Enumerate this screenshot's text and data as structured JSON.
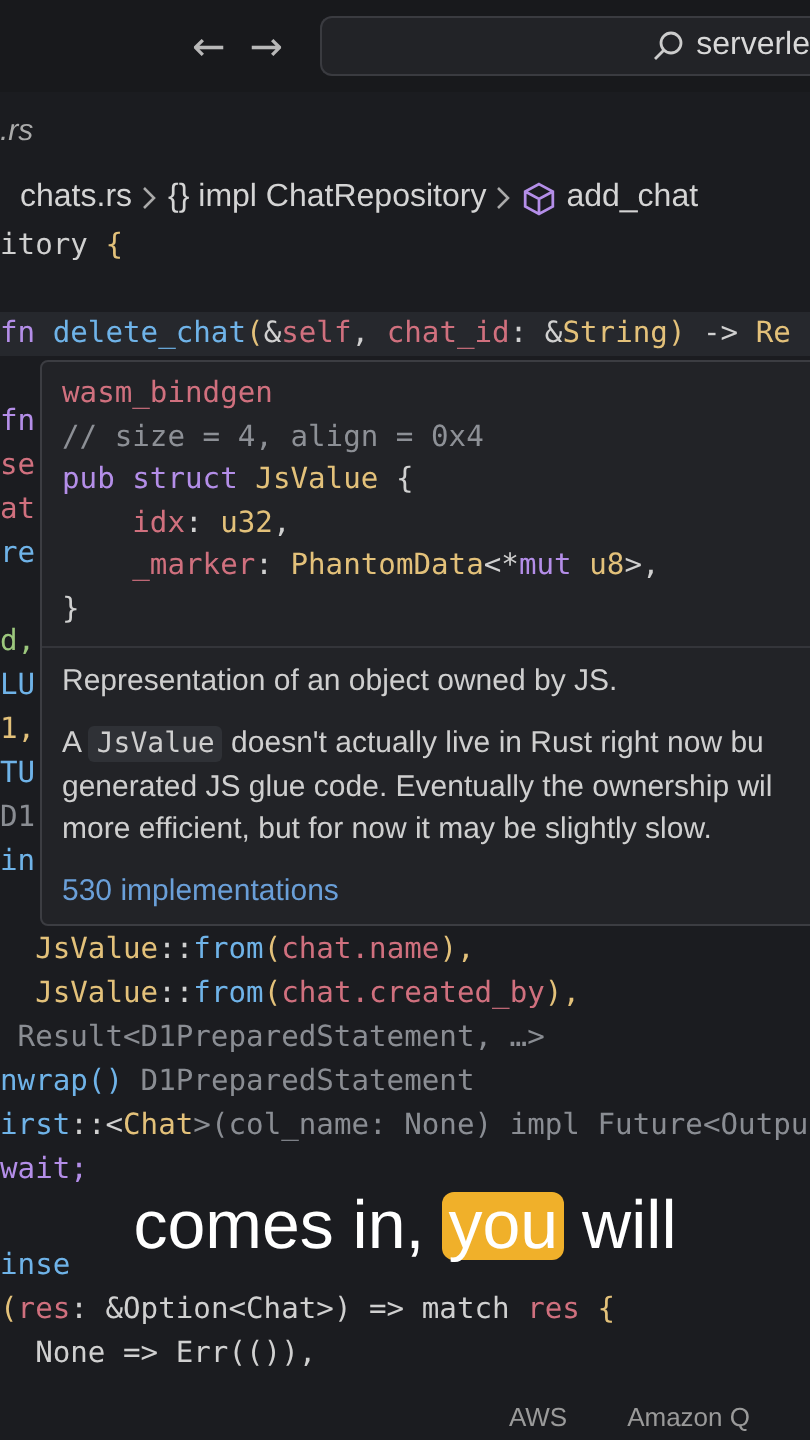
{
  "topbar": {
    "back": "←",
    "forward": "→",
    "search": "serverle"
  },
  "tab": {
    "label": ".rs"
  },
  "breadcrumb": [
    {
      "text": "chats.rs",
      "kind": "file"
    },
    {
      "text": "{} impl ChatRepository",
      "kind": "scope"
    },
    {
      "text": "add_chat",
      "kind": "method"
    }
  ],
  "code_blocks": [
    [
      {
        "segments": [
          {
            "text": "itory ",
            "kind": "plain"
          },
          {
            "text": "{",
            "kind": "type"
          }
        ]
      }
    ],
    [
      {
        "current": true,
        "segments": [
          {
            "text": "fn ",
            "kind": "kw"
          },
          {
            "text": "delete_chat",
            "kind": "fn"
          },
          {
            "text": "(",
            "kind": "type"
          },
          {
            "text": "&",
            "kind": "plain"
          },
          {
            "text": "self",
            "kind": "var"
          },
          {
            "text": ", ",
            "kind": "plain"
          },
          {
            "text": "chat_id",
            "kind": "var"
          },
          {
            "text": ": &",
            "kind": "plain"
          },
          {
            "text": "String",
            "kind": "type"
          },
          {
            "text": ")",
            "kind": "type"
          },
          {
            "text": " -> ",
            "kind": "plain"
          },
          {
            "text": "Re",
            "kind": "type"
          }
        ]
      }
    ],
    [
      {
        "segments": [
          {
            "text": "fn",
            "kind": "kw"
          }
        ]
      },
      {
        "segments": [
          {
            "text": "se",
            "kind": "var"
          }
        ]
      },
      {
        "segments": [
          {
            "text": "at",
            "kind": "var"
          }
        ]
      },
      {
        "segments": [
          {
            "text": "re",
            "kind": "fn"
          }
        ]
      }
    ],
    [
      {
        "segments": [
          {
            "text": "d,",
            "kind": "str"
          }
        ]
      },
      {
        "segments": [
          {
            "text": "LU",
            "kind": "fn"
          }
        ]
      },
      {
        "segments": [
          {
            "text": "1,",
            "kind": "type"
          }
        ]
      },
      {
        "segments": [
          {
            "text": "TU",
            "kind": "fn"
          }
        ]
      },
      {
        "segments": [
          {
            "text": "D1",
            "kind": "hint"
          }
        ]
      },
      {
        "segments": [
          {
            "text": "in",
            "kind": "fn"
          }
        ]
      }
    ],
    [
      {
        "segments": [
          {
            "text": "  JsValue",
            "kind": "type"
          },
          {
            "text": "::",
            "kind": "plain"
          },
          {
            "text": "from",
            "kind": "fn"
          },
          {
            "text": "(",
            "kind": "type"
          },
          {
            "text": "chat.name",
            "kind": "var"
          },
          {
            "text": "),",
            "kind": "type"
          }
        ]
      },
      {
        "segments": [
          {
            "text": "  JsValue",
            "kind": "type"
          },
          {
            "text": "::",
            "kind": "plain"
          },
          {
            "text": "from",
            "kind": "fn"
          },
          {
            "text": "(",
            "kind": "type"
          },
          {
            "text": "chat.created_by",
            "kind": "var"
          },
          {
            "text": "),",
            "kind": "type"
          }
        ]
      },
      {
        "segments": [
          {
            "text": " Result<D1PreparedStatement, …>",
            "kind": "hint"
          }
        ]
      },
      {
        "segments": [
          {
            "text": "nwrap() ",
            "kind": "fn"
          },
          {
            "text": "D1PreparedStatement",
            "kind": "hint"
          }
        ]
      },
      {
        "segments": [
          {
            "text": "irst",
            "kind": "fn"
          },
          {
            "text": "::<",
            "kind": "plain"
          },
          {
            "text": "Chat",
            "kind": "type"
          },
          {
            "text": ">(col_name: None) impl Future<Outpu",
            "kind": "hint"
          }
        ]
      },
      {
        "segments": [
          {
            "text": "wait;",
            "kind": "kw"
          }
        ]
      }
    ],
    [
      {
        "segments": [
          {
            "text": "inse",
            "kind": "fn"
          }
        ]
      },
      {
        "segments": [
          {
            "text": "(",
            "kind": "type"
          },
          {
            "text": "res",
            "kind": "var"
          },
          {
            "text": ": &Option<Chat>) => match ",
            "kind": "plain"
          },
          {
            "text": "res",
            "kind": "var"
          },
          {
            "text": " {",
            "kind": "type"
          }
        ]
      },
      {
        "segments": [
          {
            "text": "  None => Err(()),",
            "kind": "plain"
          }
        ]
      }
    ]
  ],
  "hover": {
    "signature": [
      [
        {
          "text": "wasm_bindgen",
          "kind": "var"
        }
      ],
      [
        {
          "text": "// size = 4, align = 0x4",
          "kind": "comment"
        }
      ],
      [
        {
          "text": "pub struct ",
          "kind": "kw"
        },
        {
          "text": "JsValue ",
          "kind": "type"
        },
        {
          "text": "{",
          "kind": "plain"
        }
      ],
      [
        {
          "text": "    idx",
          "kind": "var"
        },
        {
          "text": ": ",
          "kind": "plain"
        },
        {
          "text": "u32",
          "kind": "type"
        },
        {
          "text": ",",
          "kind": "plain"
        }
      ],
      [
        {
          "text": "    _marker",
          "kind": "var"
        },
        {
          "text": ": ",
          "kind": "plain"
        },
        {
          "text": "PhantomData",
          "kind": "type"
        },
        {
          "text": "<*",
          "kind": "plain"
        },
        {
          "text": "mut ",
          "kind": "kw"
        },
        {
          "text": "u8",
          "kind": "type"
        },
        {
          "text": ">,",
          "kind": "plain"
        }
      ],
      [
        {
          "text": "}",
          "kind": "plain"
        }
      ]
    ],
    "summary": "Representation of an object owned by JS.",
    "detail": {
      "before": "A",
      "code": "JsValue",
      "lines": [
        "doesn't actually live in Rust right now bu",
        "generated JS glue code. Eventually the ownership wil",
        "more efficient, but for now it may be slightly slow."
      ]
    },
    "link": "530 implementations"
  },
  "caption": [
    {
      "text": "comes in,",
      "highlight": false
    },
    {
      "text": "you",
      "highlight": true
    },
    {
      "text": "will",
      "highlight": false
    }
  ],
  "status_bar": [
    "AWS",
    "Amazon Q"
  ]
}
